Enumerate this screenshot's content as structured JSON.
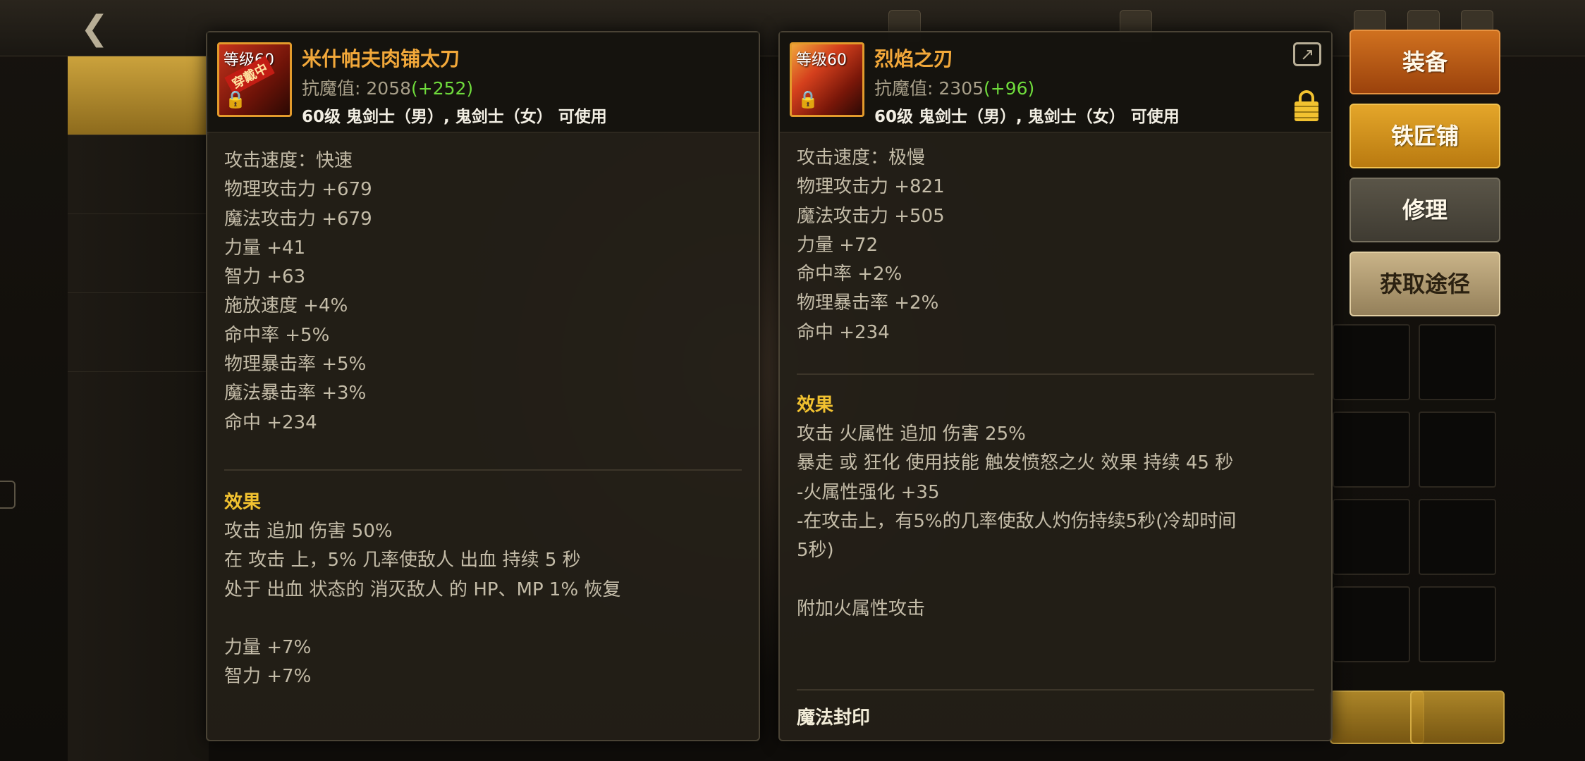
{
  "colors": {
    "item_name": "#f2a83a",
    "bonus_green": "#6fdb3c",
    "section_gold": "#f2c230",
    "equip_button": "#c0601a",
    "smith_button": "#d59520",
    "repair_button": "#4b473c",
    "source_button": "#b39d72"
  },
  "left_panel": {
    "icon": {
      "level_text": "等级60",
      "equipped_tag": "穿戴中",
      "lock_icon": "lock-icon"
    },
    "name": "米什帕夫肉铺太刀",
    "resist_label": "抗魔值:",
    "resist_value": "2058",
    "resist_bonus": "(+252)",
    "usable": "60级 鬼剑士（男）, 鬼剑士（女） 可使用",
    "stats": [
      "攻击速度：快速",
      "物理攻击力 +679",
      "魔法攻击力 +679",
      "力量 +41",
      "智力 +63",
      "施放速度 +4%",
      "命中率 +5%",
      "物理暴击率 +5%",
      "魔法暴击率 +3%",
      "命中 +234"
    ],
    "effect_title": "效果",
    "effects": [
      "攻击 追加 伤害 50%",
      "在 攻击 上，5% 几率使敌人 出血 持续 5 秒",
      "处于 出血 状态的 消灭敌人 的 HP、MP 1% 恢复",
      "",
      "力量 +7%",
      "智力 +7%"
    ]
  },
  "right_panel": {
    "icon": {
      "level_text": "等级60",
      "lock_icon": "lock-icon"
    },
    "name": "烈焰之刃",
    "resist_label": "抗魔值:",
    "resist_value": "2305",
    "resist_bonus": "(+96)",
    "usable": "60级 鬼剑士（男）, 鬼剑士（女） 可使用",
    "share_icon": "share-icon",
    "lock_icon": "lock-icon",
    "stats": [
      "攻击速度：极慢",
      "物理攻击力 +821",
      "魔法攻击力 +505",
      "力量 +72",
      "命中率 +2%",
      "物理暴击率 +2%",
      "命中 +234"
    ],
    "effect_title": "效果",
    "effects": [
      "攻击 火属性 追加 伤害 25%",
      "暴走 或 狂化 使用技能 触发愤怒之火 效果 持续 45 秒",
      "-火属性强化 +35",
      "-在攻击上，有5%的几率使敌人灼伤持续5秒(冷却时间",
      "5秒)",
      "",
      "附加火属性攻击"
    ],
    "seal_title": "魔法封印"
  },
  "actions": {
    "equip": "装备",
    "smith": "铁匠铺",
    "repair": "修理",
    "source": "获取途径"
  }
}
